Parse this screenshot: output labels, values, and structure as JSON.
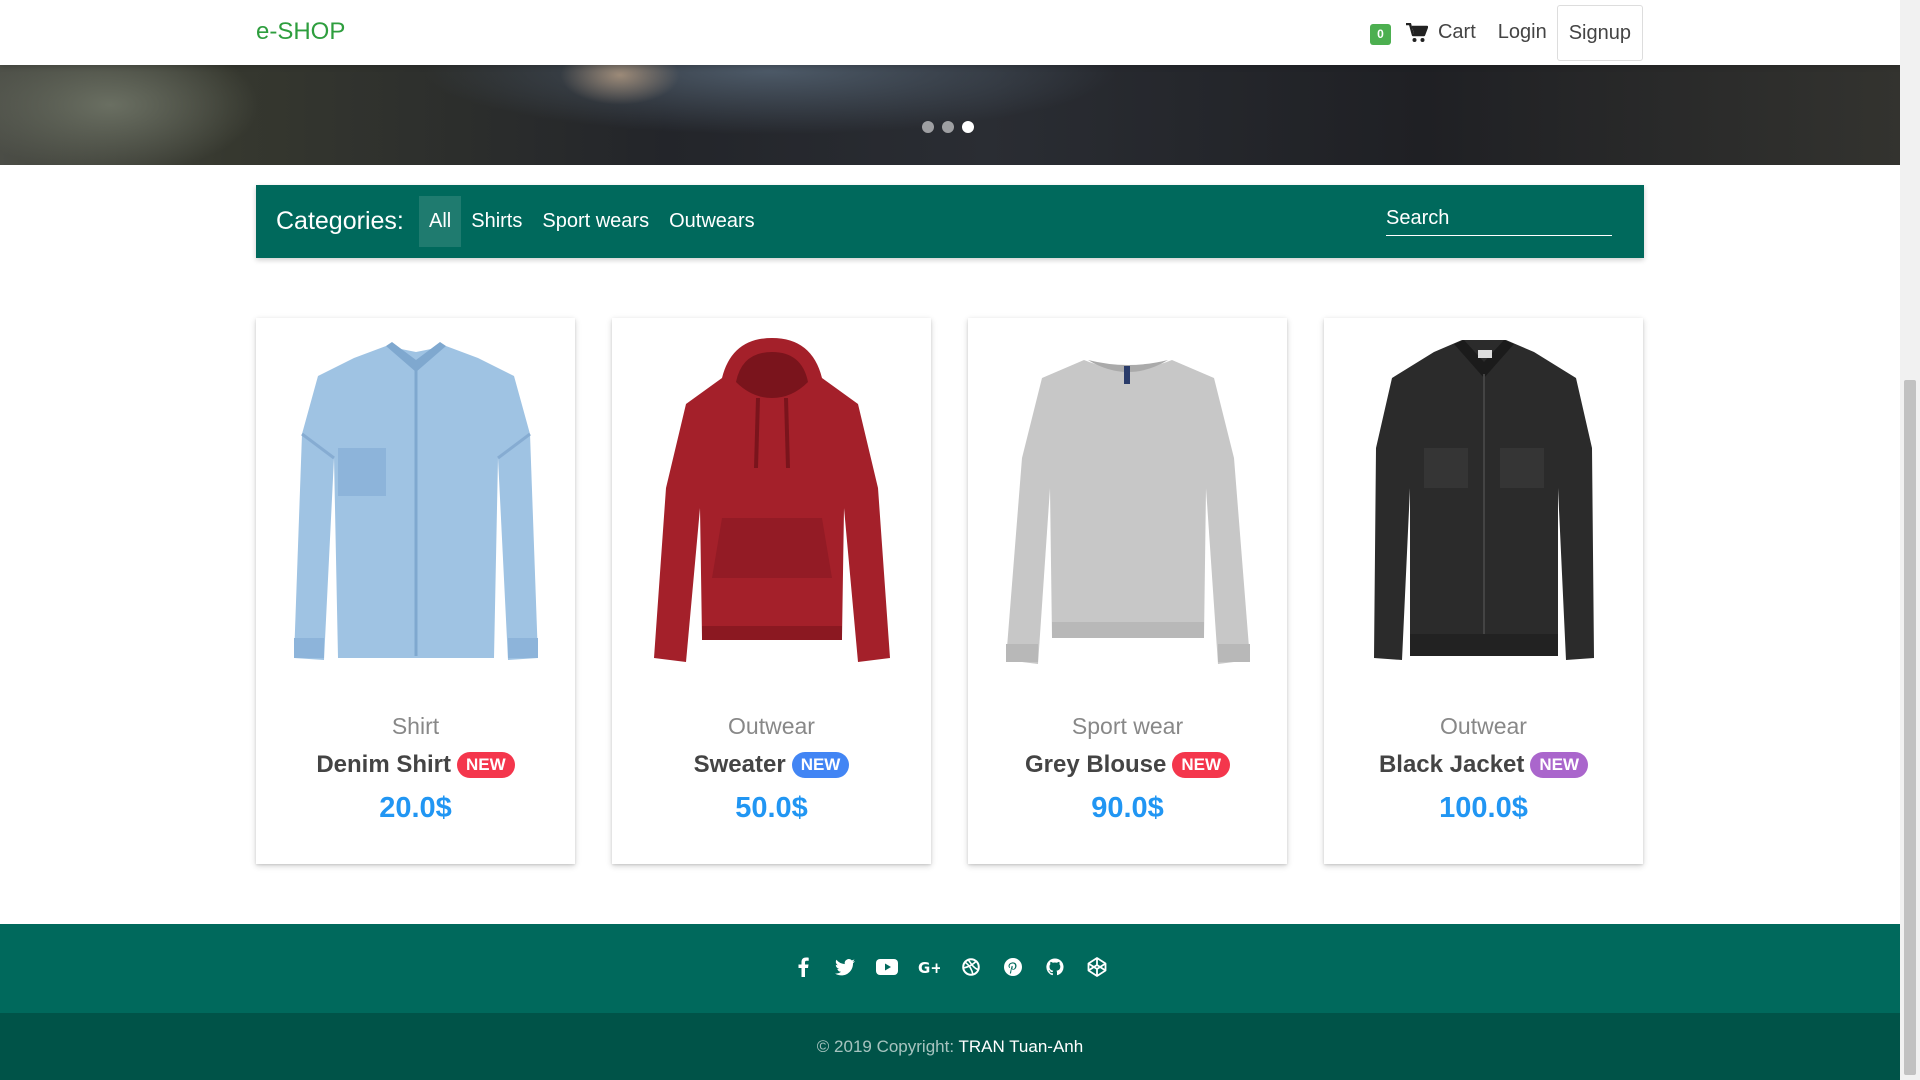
{
  "navbar": {
    "brand": "e-SHOP",
    "cart_count": "0",
    "cart_label": "Cart",
    "login_label": "Login",
    "signup_label": "Signup",
    "cart_icon": "shopping-cart-icon"
  },
  "carousel": {
    "slides": 3,
    "active_slide": 3
  },
  "categories": {
    "title": "Categories:",
    "items": [
      "All",
      "Shirts",
      "Sport wears",
      "Outwears"
    ],
    "active": "All",
    "search_placeholder": "Search"
  },
  "products": [
    {
      "category": "Shirt",
      "name": "Denim Shirt",
      "badge": "NEW",
      "badge_color": "#f4364c",
      "price": "20.0$",
      "image": "denim-shirt",
      "color": "#9fc3e3"
    },
    {
      "category": "Outwear",
      "name": "Sweater",
      "badge": "NEW",
      "badge_color": "#4285f4",
      "price": "50.0$",
      "image": "red-hoodie",
      "color": "#a4202a"
    },
    {
      "category": "Sport wear",
      "name": "Grey Blouse",
      "badge": "NEW",
      "badge_color": "#f4364c",
      "price": "90.0$",
      "image": "grey-sweatshirt",
      "color": "#c7c7c7"
    },
    {
      "category": "Outwear",
      "name": "Black Jacket",
      "badge": "NEW",
      "badge_color": "#aa66cc",
      "price": "100.0$",
      "image": "black-denim-jacket",
      "color": "#2b2b2b"
    }
  ],
  "footer": {
    "social_icons": [
      "facebook-icon",
      "twitter-icon",
      "youtube-icon",
      "google-plus-icon",
      "dribbble-icon",
      "pinterest-icon",
      "github-icon",
      "codepen-icon"
    ],
    "copyright_prefix": "© 2019 Copyright:",
    "author": "TRAN Tuan-Anh"
  },
  "colors": {
    "primary": "#00695c",
    "footer_dark": "#005348",
    "brand": "#2e9e3e",
    "price": "#2196f3",
    "cart_badge": "#4caf50"
  }
}
